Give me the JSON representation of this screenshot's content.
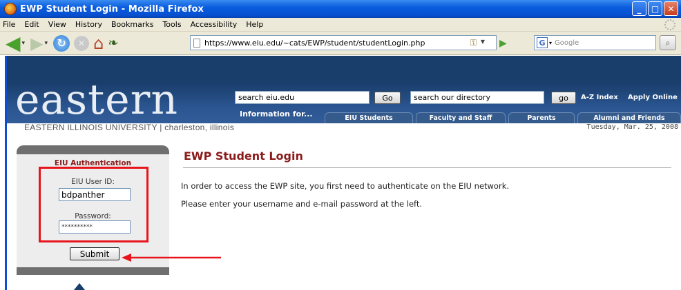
{
  "window": {
    "title": "EWP Student Login - Mozilla Firefox",
    "controls": [
      "_",
      "□",
      "✕"
    ]
  },
  "menu": [
    "File",
    "Edit",
    "View",
    "History",
    "Bookmarks",
    "Tools",
    "Accessibility",
    "Help"
  ],
  "toolbar": {
    "url": "https://www.eiu.edu/~cats/EWP/student/studentLogin.php",
    "search_engine": "G",
    "search_placeholder": "Google"
  },
  "site": {
    "wordmark": "eastern",
    "search_eiu_value": "search eiu.edu",
    "go_label": "Go",
    "search_directory_value": "search our directory",
    "go2_label": "go",
    "az_index": "A-Z Index",
    "apply_online": "Apply Online",
    "info_for": "Information for...",
    "tabs": [
      "EIU Students",
      "Faculty and Staff",
      "Parents",
      "Alumni and Friends"
    ],
    "university_line": "EASTERN ILLINOIS UNIVERSITY | charleston, illinois",
    "date": "Tuesday, Mar. 25, 2008"
  },
  "login": {
    "title": "EIU Authentication",
    "user_label": "EIU User ID:",
    "user_value": "bdpanther",
    "password_label": "Password:",
    "password_value": "**********",
    "submit_label": "Submit"
  },
  "main": {
    "heading": "EWP Student Login",
    "line1": "In order to access the EWP site, you first need to authenticate on the EIU network.",
    "line2": "Please enter your username and e-mail password at the left."
  },
  "colors": {
    "accent_red": "#e8141b",
    "heading": "#8b1a1a",
    "banner": "#1a3e6c"
  }
}
